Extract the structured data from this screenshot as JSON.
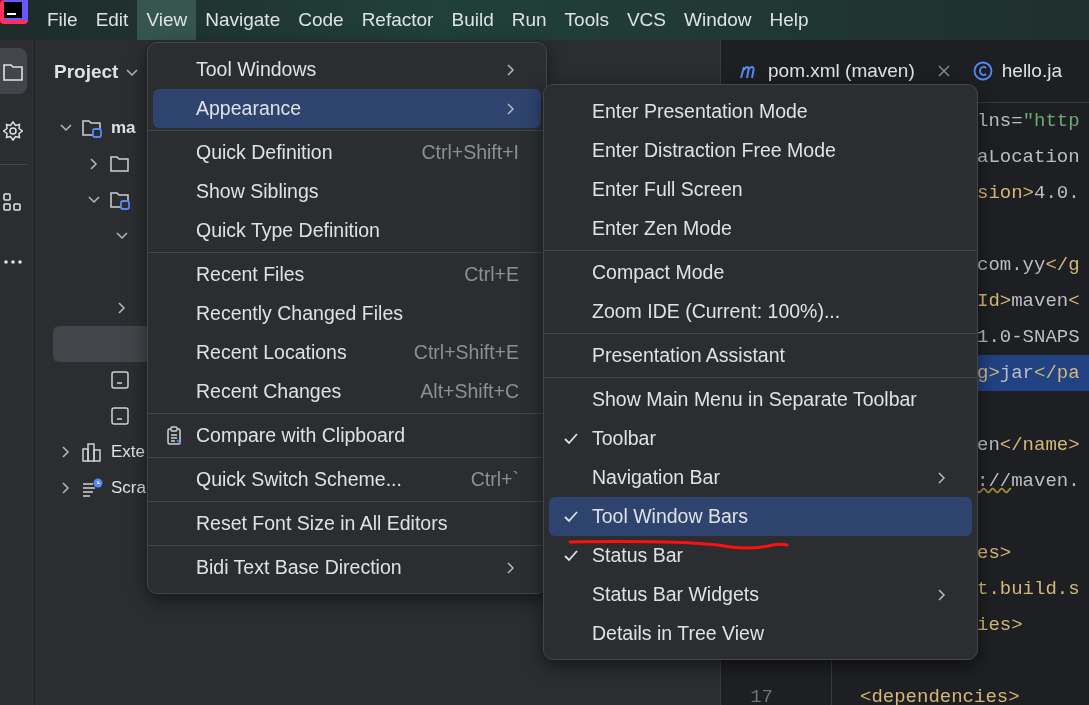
{
  "menubar": [
    {
      "label": "File",
      "selected": false
    },
    {
      "label": "Edit",
      "selected": false
    },
    {
      "label": "View",
      "selected": true
    },
    {
      "label": "Navigate",
      "selected": false
    },
    {
      "label": "Code",
      "selected": false
    },
    {
      "label": "Refactor",
      "selected": false
    },
    {
      "label": "Build",
      "selected": false
    },
    {
      "label": "Run",
      "selected": false
    },
    {
      "label": "Tools",
      "selected": false
    },
    {
      "label": "VCS",
      "selected": false
    },
    {
      "label": "Window",
      "selected": false
    },
    {
      "label": "Help",
      "selected": false
    }
  ],
  "tool_strip": [
    {
      "kind": "project",
      "selected": true
    },
    {
      "kind": "plugins",
      "selected": false
    },
    {
      "kind": "structure",
      "selected": false
    },
    {
      "kind": "more",
      "selected": false
    }
  ],
  "project_panel": {
    "title": "Project",
    "tree": [
      {
        "label": "ma",
        "kind": "module",
        "expanded": true,
        "selected": false,
        "children": [
          {
            "kind": "folder",
            "expanded": false,
            "selected": false
          },
          {
            "kind": "module",
            "expanded": true,
            "selected": false,
            "children": [
              {
                "expanded": true,
                "selected": false
              },
              {
                "expanded": false,
                "selected": false
              },
              {
                "selected": true
              }
            ]
          },
          {
            "kind": "file",
            "selected": false
          },
          {
            "kind": "file",
            "selected": false
          }
        ]
      },
      {
        "label": "Exte",
        "kind": "library",
        "expanded": false,
        "selected": false
      },
      {
        "label": "Scra",
        "kind": "scratches",
        "expanded": false,
        "selected": false
      }
    ]
  },
  "editor": {
    "tabs": [
      {
        "label": "pom.xml (maven)",
        "kind": "maven",
        "closable": true
      },
      {
        "label": "hello.ja",
        "kind": "class",
        "closable": false
      }
    ],
    "lines": [
      {
        "kind": "clipped",
        "highlighted": false,
        "segments": [
          {
            "text": "lns",
            "kind": "attr"
          },
          {
            "text": "=",
            "kind": "plain"
          },
          {
            "text": "\"http",
            "kind": "string"
          }
        ]
      },
      {
        "kind": "clipped",
        "highlighted": false,
        "segments": [
          {
            "text": "aLocation",
            "kind": "attr"
          }
        ]
      },
      {
        "kind": "clipped",
        "highlighted": false,
        "segments": [
          {
            "text": "sion>",
            "kind": "tag"
          },
          {
            "text": "4.0.",
            "kind": "plain"
          }
        ]
      },
      {
        "kind": "clipped"
      },
      {
        "kind": "clipped",
        "highlighted": false,
        "segments": [
          {
            "text": "com.yy",
            "kind": "plain"
          },
          {
            "text": "</g",
            "kind": "tag"
          }
        ]
      },
      {
        "kind": "clipped",
        "highlighted": false,
        "segments": [
          {
            "text": "Id>",
            "kind": "tag"
          },
          {
            "text": "maven",
            "kind": "plain"
          },
          {
            "text": "<",
            "kind": "tag"
          }
        ]
      },
      {
        "kind": "clipped",
        "highlighted": false,
        "segments": [
          {
            "text": "1.0-SNAPS",
            "kind": "plain"
          }
        ]
      },
      {
        "kind": "clipped",
        "highlighted": true,
        "segments": [
          {
            "text": "g>",
            "kind": "tag"
          },
          {
            "text": "jar",
            "kind": "plain"
          },
          {
            "text": "</pa",
            "kind": "tag"
          }
        ]
      },
      {
        "kind": "clipped"
      },
      {
        "kind": "clipped",
        "highlighted": false,
        "segments": [
          {
            "text": "en",
            "kind": "plain"
          },
          {
            "text": "</name>",
            "kind": "tag"
          }
        ]
      },
      {
        "kind": "clipped",
        "highlighted": false,
        "segments": [
          {
            "text": "://",
            "kind": "warn"
          },
          {
            "text": "maven.",
            "kind": "plain"
          }
        ]
      },
      {
        "kind": "clipped"
      },
      {
        "kind": "clipped",
        "highlighted": false,
        "segments": [
          {
            "text": "es>",
            "kind": "tag"
          }
        ]
      },
      {
        "kind": "clipped",
        "highlighted": false,
        "segments": [
          {
            "text": "t.build.s",
            "kind": "tag"
          }
        ]
      },
      {
        "kind": "clipped",
        "highlighted": false,
        "segments": [
          {
            "text": "ies>",
            "kind": "tag"
          }
        ]
      },
      {
        "kind": "clipped"
      },
      {
        "kind": "indented",
        "number": "17",
        "highlighted": false,
        "segments": [
          {
            "text": "<dependencies>",
            "kind": "tag"
          }
        ]
      }
    ]
  },
  "view_menu": {
    "items": [
      {
        "kind": "item",
        "label": "Tool Windows",
        "submenu": true,
        "selected": false
      },
      {
        "kind": "item",
        "label": "Appearance",
        "submenu": true,
        "selected": true
      },
      {
        "kind": "separator"
      },
      {
        "kind": "item",
        "label": "Quick Definition",
        "shortcut": "Ctrl+Shift+I",
        "submenu": false,
        "selected": false
      },
      {
        "kind": "item",
        "label": "Show Siblings",
        "submenu": false,
        "selected": false
      },
      {
        "kind": "item",
        "label": "Quick Type Definition",
        "submenu": false,
        "selected": false
      },
      {
        "kind": "separator"
      },
      {
        "kind": "item",
        "label": "Recent Files",
        "shortcut": "Ctrl+E",
        "submenu": false,
        "selected": false
      },
      {
        "kind": "item",
        "label": "Recently Changed Files",
        "submenu": false,
        "selected": false
      },
      {
        "kind": "item",
        "label": "Recent Locations",
        "shortcut": "Ctrl+Shift+E",
        "submenu": false,
        "selected": false
      },
      {
        "kind": "item",
        "label": "Recent Changes",
        "shortcut": "Alt+Shift+C",
        "submenu": false,
        "selected": false
      },
      {
        "kind": "separator"
      },
      {
        "kind": "clipboard_item",
        "label": "Compare with Clipboard",
        "submenu": false,
        "selected": false
      },
      {
        "kind": "separator"
      },
      {
        "kind": "item",
        "label": "Quick Switch Scheme...",
        "shortcut": "Ctrl+`",
        "submenu": false,
        "selected": false
      },
      {
        "kind": "separator"
      },
      {
        "kind": "item",
        "label": "Reset Font Size in All Editors",
        "submenu": false,
        "selected": false
      },
      {
        "kind": "separator"
      },
      {
        "kind": "item",
        "label": "Bidi Text Base Direction",
        "submenu": true,
        "selected": false
      }
    ]
  },
  "appearance_submenu": {
    "items": [
      {
        "kind": "item",
        "label": "Enter Presentation Mode",
        "checked": false,
        "submenu": false,
        "selected": false
      },
      {
        "kind": "item",
        "label": "Enter Distraction Free Mode",
        "checked": false,
        "submenu": false,
        "selected": false
      },
      {
        "kind": "item",
        "label": "Enter Full Screen",
        "checked": false,
        "submenu": false,
        "selected": false
      },
      {
        "kind": "item",
        "label": "Enter Zen Mode",
        "checked": false,
        "submenu": false,
        "selected": false
      },
      {
        "kind": "separator"
      },
      {
        "kind": "item",
        "label": "Compact Mode",
        "checked": false,
        "submenu": false,
        "selected": false
      },
      {
        "kind": "item",
        "label": "Zoom IDE (Current: 100%)...",
        "checked": false,
        "submenu": false,
        "selected": false
      },
      {
        "kind": "separator"
      },
      {
        "kind": "item",
        "label": "Presentation Assistant",
        "checked": false,
        "submenu": false,
        "selected": false
      },
      {
        "kind": "separator"
      },
      {
        "kind": "item",
        "label": "Show Main Menu in Separate Toolbar",
        "checked": false,
        "submenu": false,
        "selected": false
      },
      {
        "kind": "item",
        "label": "Toolbar",
        "checked": true,
        "submenu": false,
        "selected": false
      },
      {
        "kind": "item",
        "label": "Navigation Bar",
        "checked": false,
        "submenu": true,
        "selected": false
      },
      {
        "kind": "item",
        "label": "Tool Window Bars",
        "checked": true,
        "submenu": false,
        "selected": true
      },
      {
        "kind": "item",
        "label": "Status Bar",
        "checked": true,
        "submenu": false,
        "selected": false
      },
      {
        "kind": "item",
        "label": "Status Bar Widgets",
        "checked": false,
        "submenu": true,
        "selected": false
      },
      {
        "kind": "item",
        "label": "Details in Tree View",
        "checked": false,
        "submenu": false,
        "selected": false
      }
    ]
  }
}
